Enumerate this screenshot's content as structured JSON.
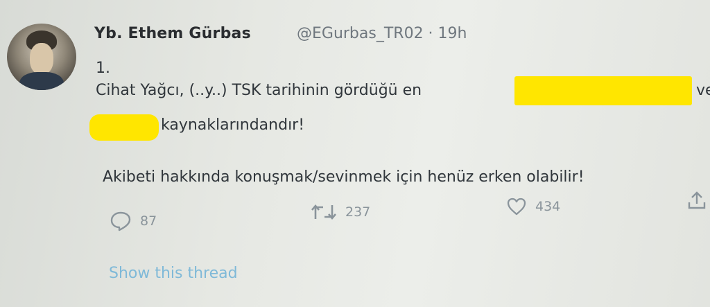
{
  "tweet": {
    "author_name": "Yb. Ethem Gürbas",
    "handle_time": "@EGurbas_TR02 · 19h",
    "number": "1.",
    "line1": "Cihat Yağcı, (..y..) TSK tarihinin gördüğü en",
    "line1_tail": "ve",
    "line2": "kaynaklarındandır!",
    "line3": "Akibeti hakkında konuşmak/sevinmek için henüz erken olabilir!",
    "reply_count": "87",
    "retweet_count": "237",
    "like_count": "434",
    "show_thread": "Show this thread"
  },
  "icons": {
    "reply": "reply-icon",
    "retweet": "retweet-icon",
    "like": "heart-icon",
    "share": "share-icon"
  },
  "colors": {
    "redaction": "#ffe600",
    "link": "#7fb9d8",
    "muted": "#8a949b"
  }
}
